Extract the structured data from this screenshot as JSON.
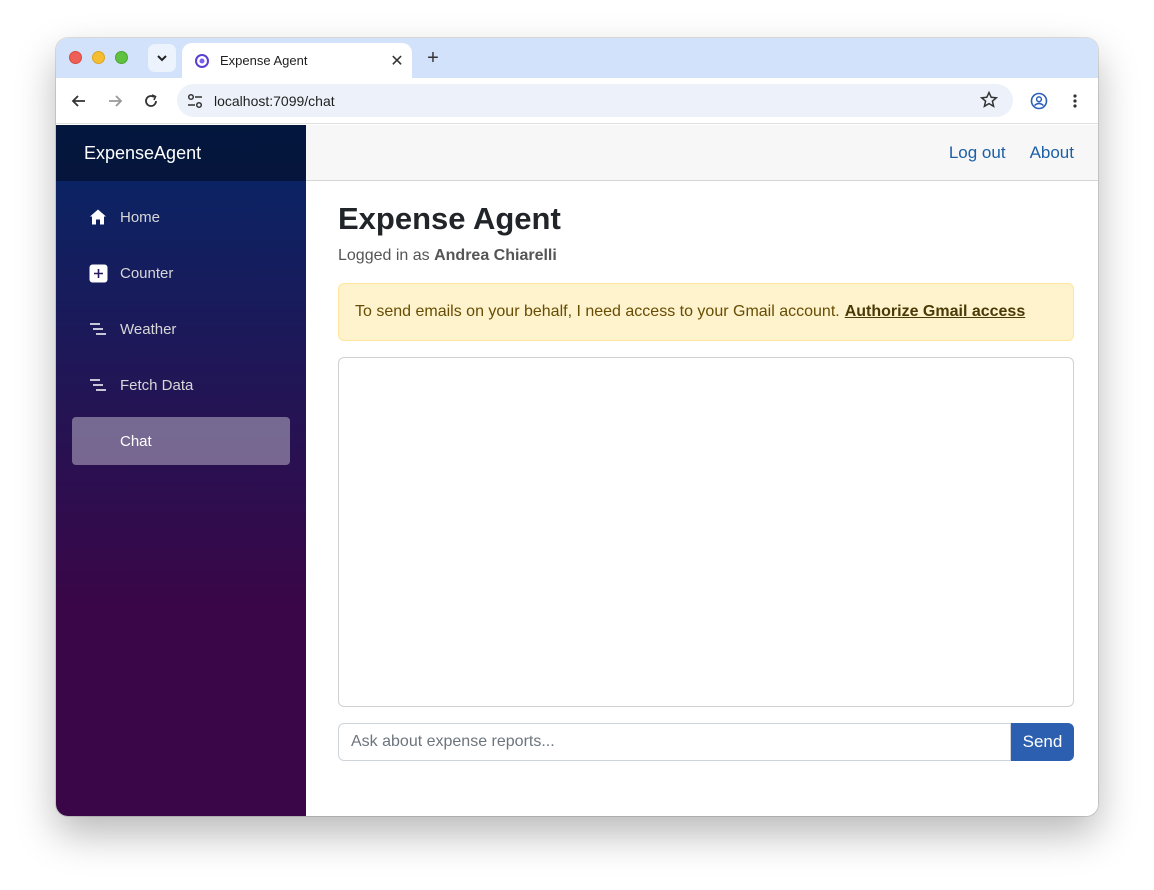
{
  "browser": {
    "tab_title": "Expense Agent",
    "tab_close": "✕",
    "new_tab": "+",
    "url": "localhost:7099/chat"
  },
  "sidebar": {
    "brand": "ExpenseAgent",
    "items": [
      {
        "label": "Home",
        "icon": "home-icon"
      },
      {
        "label": "Counter",
        "icon": "plus-square-icon"
      },
      {
        "label": "Weather",
        "icon": "list-icon"
      },
      {
        "label": "Fetch Data",
        "icon": "list-icon"
      },
      {
        "label": "Chat",
        "icon": "",
        "active": true
      }
    ]
  },
  "header": {
    "logout": "Log out",
    "about": "About"
  },
  "main": {
    "title": "Expense Agent",
    "logged_prefix": "Logged in as",
    "user": "Andrea Chiarelli",
    "alert_text": "To send emails on your behalf, I need access to your Gmail account.",
    "alert_link": "Authorize Gmail access",
    "input_placeholder": "Ask about expense reports...",
    "send_label": "Send"
  },
  "colors": {
    "accent": "#2d5fb0",
    "sidebar_top": "#052767",
    "sidebar_bottom": "#3a0647",
    "alert_bg": "#fff3cd"
  }
}
